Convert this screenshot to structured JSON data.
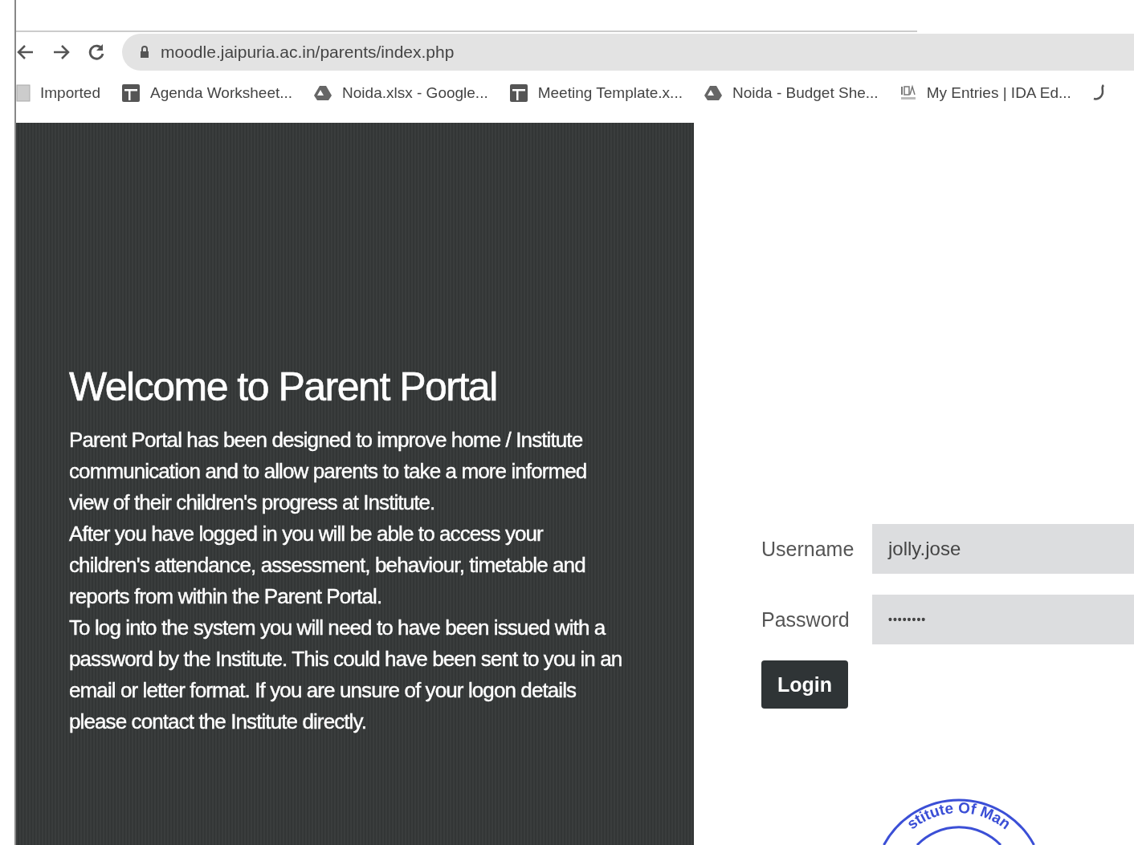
{
  "browser": {
    "url": "moodle.jaipuria.ac.in/parents/index.php",
    "bookmarks": [
      {
        "label": "Imported",
        "kind": "folder"
      },
      {
        "label": "Agenda Worksheet...",
        "kind": "sheet"
      },
      {
        "label": "Noida.xlsx - Google...",
        "kind": "drive"
      },
      {
        "label": "Meeting Template.x...",
        "kind": "sheet"
      },
      {
        "label": "Noida - Budget She...",
        "kind": "drive"
      },
      {
        "label": "My Entries | IDA Ed...",
        "kind": "ida"
      },
      {
        "kind": "partial"
      }
    ]
  },
  "welcome": {
    "title": "Welcome to Parent Portal",
    "paragraphs": [
      "Parent Portal has been designed to improve home / Institute communication and to allow parents to take a more informed view of their children's progress at Institute.",
      "After you have logged in you will be able to access your children's attendance, assessment, behaviour, timetable and reports from within the Parent Portal.",
      "To log into the system you will need to have been issued with a password by the Institute. This could have been sent to you in an email or letter format. If you are unsure of your logon details please contact the Institute directly."
    ]
  },
  "login": {
    "fields": [
      {
        "label": "Username",
        "value": "jolly.jose",
        "kind": "text"
      },
      {
        "label": "Password",
        "value": "••••••••",
        "kind": "password"
      }
    ],
    "button": "Login"
  },
  "stamp": {
    "text": "stitute Of Man"
  }
}
